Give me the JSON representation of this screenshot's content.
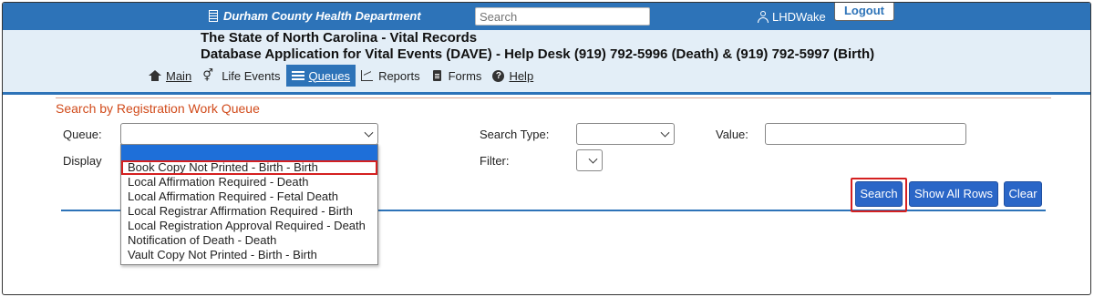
{
  "header": {
    "department": "Durham County Health Department",
    "search_placeholder": "Search",
    "username": "LHDWake",
    "logout_label": "Logout",
    "title_line1": "The State of North Carolina - Vital Records",
    "title_line2": "Database Application for Vital Events (DAVE) - Help Desk (919) 792-5996 (Death) & (919) 792-5997 (Birth)"
  },
  "nav": {
    "items": [
      {
        "label": "Main",
        "icon": "home-icon"
      },
      {
        "label": "Life Events",
        "icon": "gender-icon"
      },
      {
        "label": "Queues",
        "icon": "list-icon",
        "active": true
      },
      {
        "label": "Reports",
        "icon": "chart-icon"
      },
      {
        "label": "Forms",
        "icon": "document-icon"
      },
      {
        "label": "Help",
        "icon": "help-icon"
      }
    ]
  },
  "search_form": {
    "section_title": "Search by Registration Work Queue",
    "queue_label": "Queue:",
    "display_label": "Display",
    "search_type_label": "Search Type:",
    "value_label": "Value:",
    "filter_label": "Filter:",
    "queue_options": [
      "Book Copy Not Printed - Birth - Birth",
      "Local Affirmation Required - Death",
      "Local Affirmation Required - Fetal Death",
      "Local Registrar Affirmation Required - Birth",
      "Local Registration Approval Required - Death",
      "Notification of Death - Death",
      "Vault Copy Not Printed - Birth - Birth"
    ],
    "buttons": {
      "search": "Search",
      "show_all_rows": "Show All Rows",
      "clear": "Clear"
    }
  },
  "colors": {
    "primary_blue": "#2d73b8",
    "header_band": "#e3eef7",
    "section_title": "#d14b1b",
    "highlight_red": "#d42020",
    "button_blue": "#2a66c7"
  }
}
